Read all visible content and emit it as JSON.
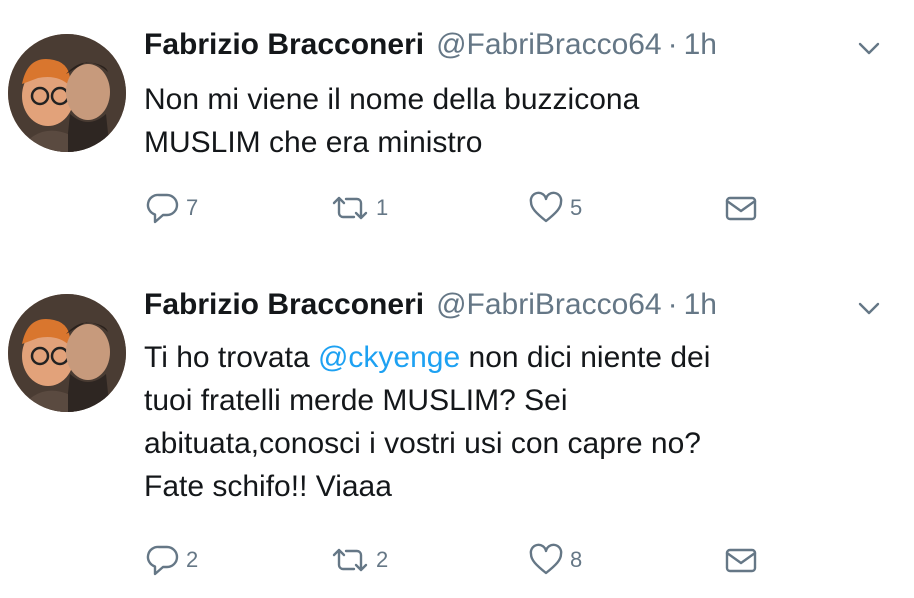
{
  "tweets": [
    {
      "name": "Fabrizio Bracconeri",
      "handle": "@FabriBracco64",
      "separator": "·",
      "time": "1h",
      "text_parts": [
        "Non mi viene il nome della buzzicona\nMUSLIM che era ministro"
      ],
      "replies": "7",
      "retweets": "1",
      "likes": "5"
    },
    {
      "name": "Fabrizio Bracconeri",
      "handle": "@FabriBracco64",
      "separator": "·",
      "time": "1h",
      "text_before": "Ti ho trovata ",
      "mention": "@ckyenge",
      "text_after": " non dici niente dei\ntuoi fratelli merde MUSLIM? Sei\nabituata,conosci i vostri usi con capre no?\nFate schifo!! Viaaa",
      "replies": "2",
      "retweets": "2",
      "likes": "8"
    }
  ],
  "colors": {
    "text": "#14171a",
    "secondary": "#657786",
    "mention": "#1da1f2"
  },
  "icons": [
    "reply-icon",
    "retweet-icon",
    "like-icon",
    "direct-message-icon",
    "chevron-down-icon"
  ]
}
